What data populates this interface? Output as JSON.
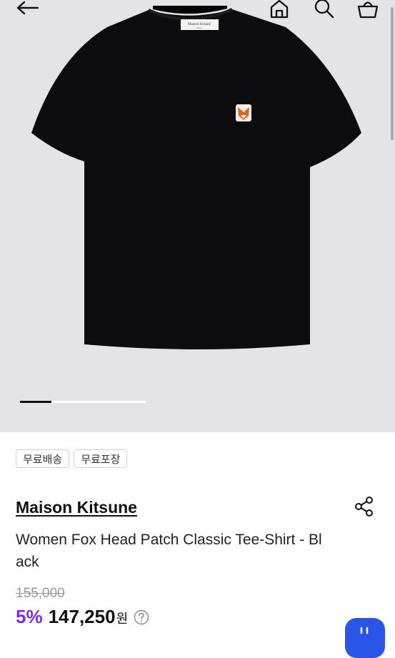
{
  "hero": {
    "shirt_color": "#0d0d0f",
    "background": "#e4e4e6",
    "label_text": "Maison Kitsuné",
    "pager": {
      "current": 1,
      "total": 4
    }
  },
  "top_icons": [
    "back-arrow-icon",
    "home-icon",
    "search-icon",
    "cart-icon"
  ],
  "badges": [
    "무료배송",
    "무료포장"
  ],
  "product": {
    "brand": "Maison Kitsune",
    "name": "Women Fox Head Patch Classic Tee-Shirt - Black",
    "original_price": "155,000",
    "discount": "5%",
    "price": "147,250",
    "currency": "원"
  },
  "colors": {
    "discount": "#7a2fdd",
    "fab": "#2b55e6"
  }
}
